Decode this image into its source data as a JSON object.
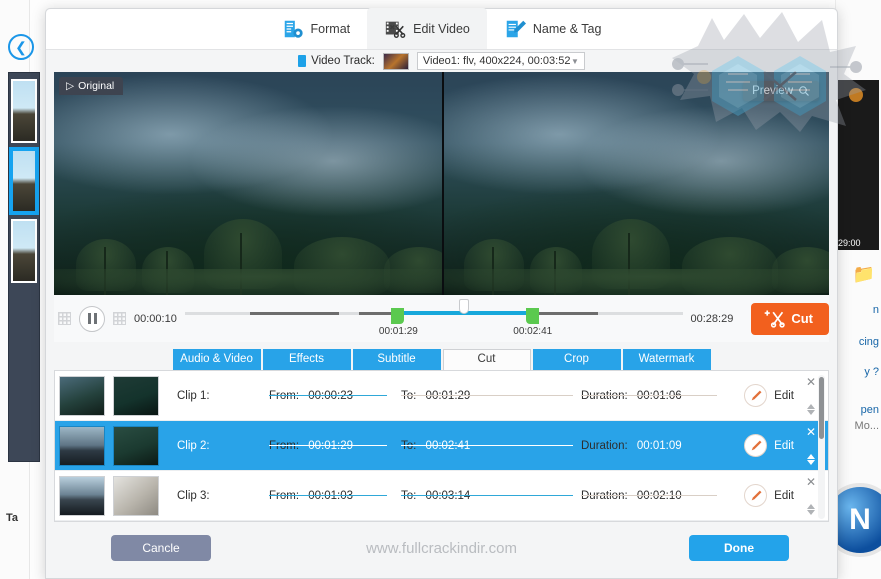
{
  "background_app": {
    "back_icon": "back-arrow-icon",
    "tag_text": "Ta",
    "right_thumb_time": "29:00",
    "folder_icon": "folder-icon",
    "right_texts": [
      "n",
      "cing",
      "y ?",
      "pen",
      "Mo..."
    ],
    "logo_letter": "N"
  },
  "dialog": {
    "top_tabs": [
      {
        "label": "Format",
        "icon": "format-document-icon",
        "active": false
      },
      {
        "label": "Edit Video",
        "icon": "film-scissors-icon",
        "active": true
      },
      {
        "label": "Name & Tag",
        "icon": "name-tag-pencil-icon",
        "active": false
      }
    ],
    "original_badge": "Original",
    "video_track": {
      "label": "Video Track:",
      "selected": "Video1: flv, 400x224, 00:03:52",
      "thumbnail": "video-track-thumbnail"
    },
    "preview_button": {
      "label": "Preview",
      "icon": "magnifier-icon"
    },
    "timeline": {
      "start_time": "00:00:10",
      "end_time": "00:28:29",
      "trim_start_label": "00:01:29",
      "trim_end_label": "00:02:41",
      "pause_icon": "pause-icon",
      "grid_icon": "grid-icon",
      "cut_button": {
        "label": "Cut",
        "icon": "scissors-plus-icon"
      }
    },
    "sub_tabs": [
      {
        "label": "Audio & Video",
        "active": false
      },
      {
        "label": "Effects",
        "active": false
      },
      {
        "label": "Subtitle",
        "active": false
      },
      {
        "label": "Cut",
        "active": true
      },
      {
        "label": "Crop",
        "active": false
      },
      {
        "label": "Watermark",
        "active": false
      }
    ],
    "clip_field_labels": {
      "from": "From:",
      "to": "To:",
      "duration": "Duration:",
      "edit": "Edit"
    },
    "clips": [
      {
        "name": "Clip 1:",
        "from": "00:00:23",
        "to": "00:01:29",
        "duration": "00:01:06",
        "selected": false,
        "close_icon": "close-icon",
        "edit_icon": "pencil-icon"
      },
      {
        "name": "Clip 2:",
        "from": "00:01:29",
        "to": "00:02:41",
        "duration": "00:01:09",
        "selected": true,
        "close_icon": "close-icon",
        "edit_icon": "pencil-icon"
      },
      {
        "name": "Clip 3:",
        "from": "00:01:03",
        "to": "00:03:14",
        "duration": "00:02:10",
        "selected": false,
        "close_icon": "close-icon",
        "edit_icon": "pencil-icon"
      }
    ],
    "footer": {
      "cancel_label": "Cancle",
      "done_label": "Done",
      "watermark": "www.fullcrackindir.com"
    }
  },
  "colors": {
    "accent_blue": "#28a3e8",
    "cut_orange": "#f2601e",
    "trim_green": "#5bc94f",
    "track_cyan": "#17a8db",
    "cancel_grey": "#8089a5"
  }
}
